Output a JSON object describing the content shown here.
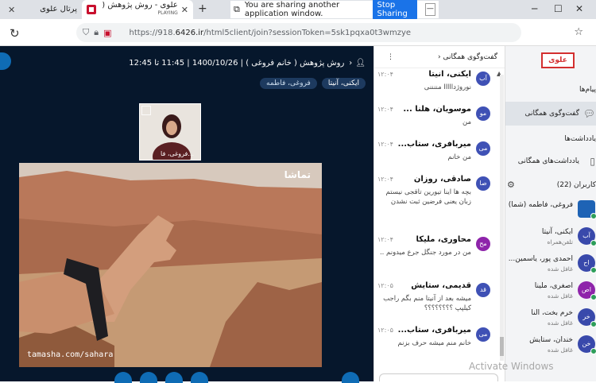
{
  "browser": {
    "tab1_label": "پرتال علوی",
    "tab2_title": "علوی - روش پژوهش ( خانم فروی...",
    "tab2_playing": "PLAYING",
    "new_tab": "+",
    "share_text": "You are sharing another application window.",
    "stop_sharing": "Stop Sharing",
    "hide": "—",
    "minimize": "─",
    "maximize": "☐",
    "close": "✕",
    "url_prefix": "https://918.",
    "url_domain": "6426.ir",
    "url_rest": "/html5client/join?sessionToken=5sk1pqxa0t3wmzye"
  },
  "meeting": {
    "title": "روش پژوهش ( خانم فروغی ) | 1400/10/26 | 11:45 تا 12:45",
    "talking_chips": [
      "ایکنی، آنیتا",
      "فروغی، فاطمه"
    ],
    "speaker_name": "فروغی، فا...",
    "video_brand": "تماشا",
    "video_url": "tamasha.com/sahara"
  },
  "chat": {
    "title": "گفت‌وگوی همگانی",
    "messages": [
      {
        "avatar": "آب",
        "author": "ایکنی، آنیتا",
        "time": "۱۲:۰۴",
        "text": "نوروژدااااا مننننی",
        "color": "#3f51b5"
      },
      {
        "avatar": "مو",
        "author": "موسویان، هلنا ...",
        "time": "۱۲:۰۴",
        "text": "من",
        "color": "#3f51b5"
      },
      {
        "avatar": "می",
        "author": "میربافری، ستاب...",
        "time": "۱۲:۰۴",
        "text": "من خانم",
        "color": "#3f51b5"
      },
      {
        "avatar": "صا",
        "author": "صادقی، روزان",
        "time": "۱۲:۰۴",
        "text": "بچه ها اینا تیورین تاقجی نیستم زبان یعنی فرضین ثبت نشدن",
        "color": "#3f51b5"
      },
      {
        "avatar": "مح",
        "author": "محاوری، ملیکا",
        "time": "۱۲:۰۴",
        "text": "من در مورد جنگل جرع میدونم ..",
        "color": "#8e24aa"
      },
      {
        "avatar": "قد",
        "author": "قدیمی، ستایش",
        "time": "۱۲:۰۵",
        "text": "میشه بعد از آنیتا منم بگم راجب کیلپپ ؟؟؟؟؟؟؟؟",
        "color": "#3f51b5"
      },
      {
        "avatar": "می",
        "author": "میربافری، ستاب...",
        "time": "۱۲:۰۵",
        "text": "خانم منم میشه حرف بزنم",
        "color": "#3f51b5"
      }
    ]
  },
  "sidebar": {
    "logo": "علوی",
    "messages_label": "پیام‌ها",
    "public_chat": "گفت‌وگوی همگانی",
    "notes_label": "یادداشت‌ها",
    "shared_notes": "یادداشت‌های همگانی",
    "users_label": "کاربران (22)",
    "users": [
      {
        "avatar": "",
        "name": "فروغی، فاطمه (شما)",
        "status": "",
        "color": "#1e63b5"
      },
      {
        "avatar": "آب",
        "name": "ایکنی، آنیتا",
        "status": "تلفن‌همراه",
        "color": "#3949ab"
      },
      {
        "avatar": "اح",
        "name": "احمدی پور، یاسمین...",
        "status": "غافل شده",
        "color": "#3949ab"
      },
      {
        "avatar": "اص",
        "name": "اصغری، ملینا",
        "status": "غافل شده",
        "color": "#8e24aa"
      },
      {
        "avatar": "خر",
        "name": "خرم بخت، النا",
        "status": "غافل شده",
        "color": "#3949ab"
      },
      {
        "avatar": "خن",
        "name": "خندان، ستایش",
        "status": "غافل شده",
        "color": "#3949ab"
      }
    ]
  },
  "overlay": {
    "activate": "Activate Windows"
  }
}
